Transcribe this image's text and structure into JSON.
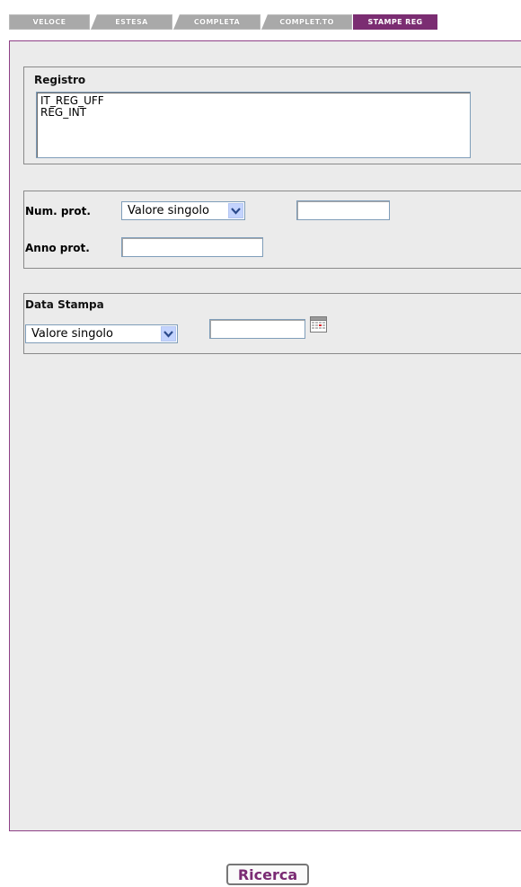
{
  "tabs": [
    {
      "label": "VELOCE",
      "active": false
    },
    {
      "label": "ESTESA",
      "active": false
    },
    {
      "label": "COMPLETA",
      "active": false
    },
    {
      "label": "COMPLET.TO",
      "active": false
    },
    {
      "label": "STAMPE REG",
      "active": true
    }
  ],
  "registro": {
    "legend": "Registro",
    "options": [
      "IT_REG_UFF",
      "REG_INT"
    ]
  },
  "protocollo": {
    "num_label": "Num. prot.",
    "num_mode": "Valore singolo",
    "num_value": "",
    "anno_label": "Anno prot.",
    "anno_value": ""
  },
  "data_stampa": {
    "legend": "Data Stampa",
    "mode": "Valore singolo",
    "value": "",
    "icon": "calendar-icon"
  },
  "actions": {
    "search_label": "Ricerca"
  },
  "colors": {
    "accent": "#7b2d72",
    "panel_bg": "#ebebeb",
    "tab_inactive": "#a9a9a9"
  }
}
